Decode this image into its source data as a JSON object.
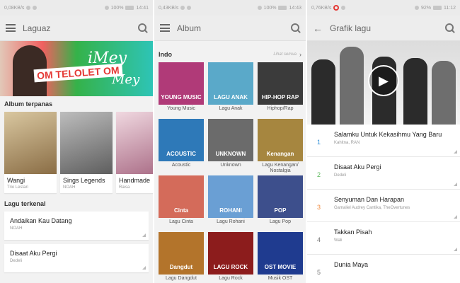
{
  "status_left": {
    "screen1": "0,08KB/s",
    "screen2": "0,43KB/s",
    "screen3": "0,76KB/s"
  },
  "status_right": {
    "screen1": {
      "battery": "100%",
      "time": "14:41"
    },
    "screen2": {
      "battery": "100%",
      "time": "14:43"
    },
    "screen3": {
      "battery": "92%",
      "time": "11:12"
    }
  },
  "screen1": {
    "title": "Laguaz",
    "banner": {
      "text_left": "OM TELOLET OM",
      "text_right_1": "iMey",
      "text_right_2": "Mey"
    },
    "albums_header": "Album terpanas",
    "albums": [
      {
        "name": "Wangi",
        "artist": "Trio Lestari",
        "art_text": "RIO ESTARI",
        "color": "#c9b28a"
      },
      {
        "name": "Sings Legends",
        "artist": "NOAH",
        "art_text": "NOAH",
        "color": "#8d8d8d"
      },
      {
        "name": "Handmade",
        "artist": "Raisa",
        "art_text": "Ra",
        "color": "#d6b7c2"
      }
    ],
    "songs_header": "Lagu terkenal",
    "songs": [
      {
        "name": "Andaikan Kau Datang",
        "artist": "NOAH"
      },
      {
        "name": "Disaat Aku Pergi",
        "artist": "Dedeli"
      }
    ]
  },
  "screen2": {
    "title": "Album",
    "section": "Indo",
    "see_all": "Lihat semua",
    "tiles": [
      {
        "caption": "Young Music",
        "art": "YOUNG MUSIC",
        "color": "#b03a78"
      },
      {
        "caption": "Lagu Anak",
        "art": "LAGU ANAK",
        "color": "#5aa9c9"
      },
      {
        "caption": "Hiphop/Rap",
        "art": "HIP-HOP RAP",
        "color": "#3b3b3b"
      },
      {
        "caption": "Acoustic",
        "art": "ACOUSTIC",
        "color": "#2e79b8"
      },
      {
        "caption": "Unknown",
        "art": "UNKNOWN",
        "color": "#6b6b6b"
      },
      {
        "caption": "Lagu Kenangan/ Nostalgia",
        "art": "Kenangan",
        "color": "#a6863f"
      },
      {
        "caption": "Lagu Cinta",
        "art": "Cinta",
        "color": "#d46b5a"
      },
      {
        "caption": "Lagu Rohani",
        "art": "ROHANI",
        "color": "#6a9fd4"
      },
      {
        "caption": "Lagu Pop",
        "art": "POP",
        "color": "#3d4f8c"
      },
      {
        "caption": "Lagu Dangdut",
        "art": "Dangdut",
        "color": "#b3742b"
      },
      {
        "caption": "Lagu Rock",
        "art": "LAGU ROCK",
        "color": "#8c1c1c"
      },
      {
        "caption": "Musik OST",
        "art": "OST MOVIE",
        "color": "#1f3b8f"
      }
    ]
  },
  "screen3": {
    "title": "Grafik lagu",
    "chart": [
      {
        "no": "1",
        "name": "Salamku Untuk Kekasihmu Yang Baru",
        "artist": "Kahitna, RAN",
        "color": "#2f8fd8"
      },
      {
        "no": "2",
        "name": "Disaat Aku Pergi",
        "artist": "Dedeli",
        "color": "#5cb85c"
      },
      {
        "no": "3",
        "name": "Senyuman Dan Harapan",
        "artist": "Gamaliel Audrey Cantika, TheOvertunes",
        "color": "#f0883a"
      },
      {
        "no": "4",
        "name": "Takkan Pisah",
        "artist": "Wali",
        "color": "#777777"
      },
      {
        "no": "5",
        "name": "Dunia Maya",
        "artist": "",
        "color": "#777777"
      }
    ]
  }
}
